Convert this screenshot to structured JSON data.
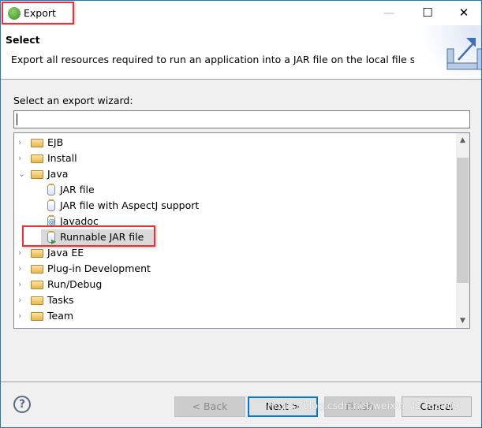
{
  "window": {
    "title": "Export",
    "icon": "eclipse-app-icon",
    "controls": [
      "minimize",
      "maximize",
      "close"
    ]
  },
  "header": {
    "title": "Select",
    "description": "Export all resources required to run an application into a JAR file on the local file system.",
    "image": "export-wizard-icon"
  },
  "filter": {
    "label": "Select an export wizard:",
    "value": "",
    "placeholder": ""
  },
  "tree": {
    "items": [
      {
        "label": "EJB",
        "type": "folder",
        "expanded": false,
        "level": 0
      },
      {
        "label": "Install",
        "type": "folder",
        "expanded": false,
        "level": 0
      },
      {
        "label": "Java",
        "type": "folder",
        "expanded": true,
        "level": 0
      },
      {
        "label": "JAR file",
        "type": "jar",
        "level": 1
      },
      {
        "label": "JAR file with AspectJ support",
        "type": "jar",
        "level": 1
      },
      {
        "label": "Javadoc",
        "type": "javadoc",
        "level": 1
      },
      {
        "label": "Runnable JAR file",
        "type": "runnable-jar",
        "level": 1,
        "selected": true
      },
      {
        "label": "Java EE",
        "type": "folder",
        "expanded": false,
        "level": 0
      },
      {
        "label": "Plug-in Development",
        "type": "folder",
        "expanded": false,
        "level": 0
      },
      {
        "label": "Run/Debug",
        "type": "folder",
        "expanded": false,
        "level": 0
      },
      {
        "label": "Tasks",
        "type": "folder",
        "expanded": false,
        "level": 0
      },
      {
        "label": "Team",
        "type": "folder",
        "expanded": false,
        "level": 0
      }
    ]
  },
  "buttons": {
    "back": "< Back",
    "next": "Next >",
    "finish": "Finish",
    "cancel": "Cancel"
  },
  "highlight_color": "#e8313a",
  "watermark": "https://blog.csdn.net/weixin_42488909"
}
